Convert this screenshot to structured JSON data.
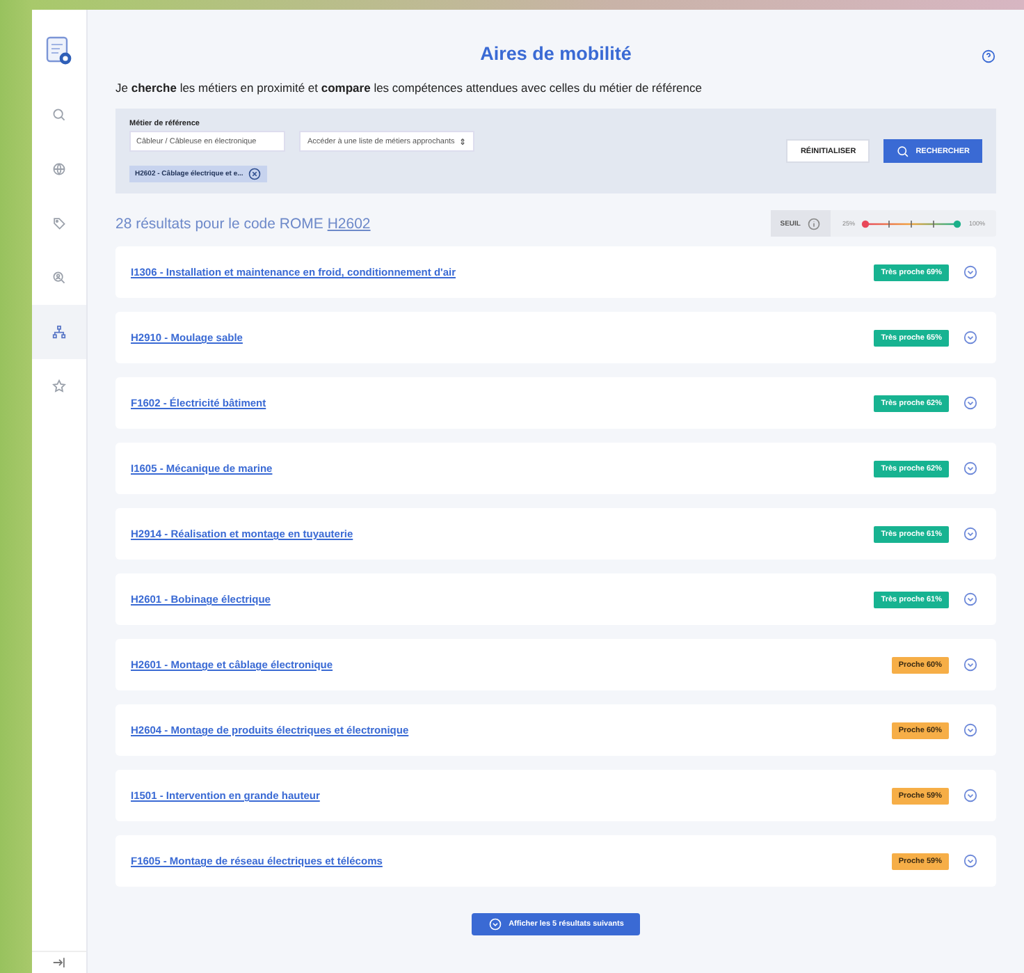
{
  "sidebar": {
    "items": [
      {
        "kind": "search",
        "selected": false
      },
      {
        "kind": "globe",
        "selected": false
      },
      {
        "kind": "tag",
        "selected": false
      },
      {
        "kind": "zoom",
        "selected": false
      },
      {
        "kind": "hierarchy",
        "selected": true
      },
      {
        "kind": "star",
        "selected": false
      }
    ]
  },
  "header": {
    "title": "Aires de mobilité",
    "intro": "Je **cherche** les métiers en proximité et **compare** les compétences attendues avec celles du métier de référence"
  },
  "search": {
    "label": "Métier de référence",
    "value": "Câbleur / Câbleuse en électronique",
    "select": "Accéder à une liste de métiers approchants",
    "select_arrow": "⇕",
    "chip": "H2602 - Câblage électrique et e...",
    "reset": "RÉINITIALISER",
    "submit": "RECHERCHER"
  },
  "summary": {
    "text": "28 résultats pour le code ROME ",
    "code": "H2602"
  },
  "threshold": {
    "label": "SEUIL",
    "min": "25%",
    "max": "100%",
    "thumbs": [
      {
        "level": 0
      },
      {
        "level": 1
      }
    ]
  },
  "results": [
    {
      "title": "I1306 - Installation et maintenance en froid, conditionnement d'air",
      "kind": "tres",
      "badge": "Très proche 69%"
    },
    {
      "title": "H2910 - Moulage sable",
      "kind": "tres",
      "badge": "Très proche 65%"
    },
    {
      "title": "F1602 - Électricité bâtiment",
      "kind": "tres",
      "badge": "Très proche 62%"
    },
    {
      "title": "I1605 - Mécanique de marine",
      "kind": "tres",
      "badge": "Très proche 62%"
    },
    {
      "title": "H2914 - Réalisation et montage en tuyauterie",
      "kind": "tres",
      "badge": "Très proche 61%"
    },
    {
      "title": "H2601 - Bobinage électrique",
      "kind": "tres",
      "badge": "Très proche 61%"
    },
    {
      "title": "H2601 - Montage et câblage électronique",
      "kind": "proche",
      "badge": "Proche 60%"
    },
    {
      "title": "H2604 - Montage de produits électriques et électronique",
      "kind": "proche",
      "badge": "Proche 60%"
    },
    {
      "title": "I1501 - Intervention en grande hauteur",
      "kind": "proche",
      "badge": "Proche 59%"
    },
    {
      "title": "F1605 - Montage de réseau électriques et télécoms",
      "kind": "proche",
      "badge": "Proche 59%"
    }
  ],
  "more": "Afficher les 5 résultats suivants"
}
